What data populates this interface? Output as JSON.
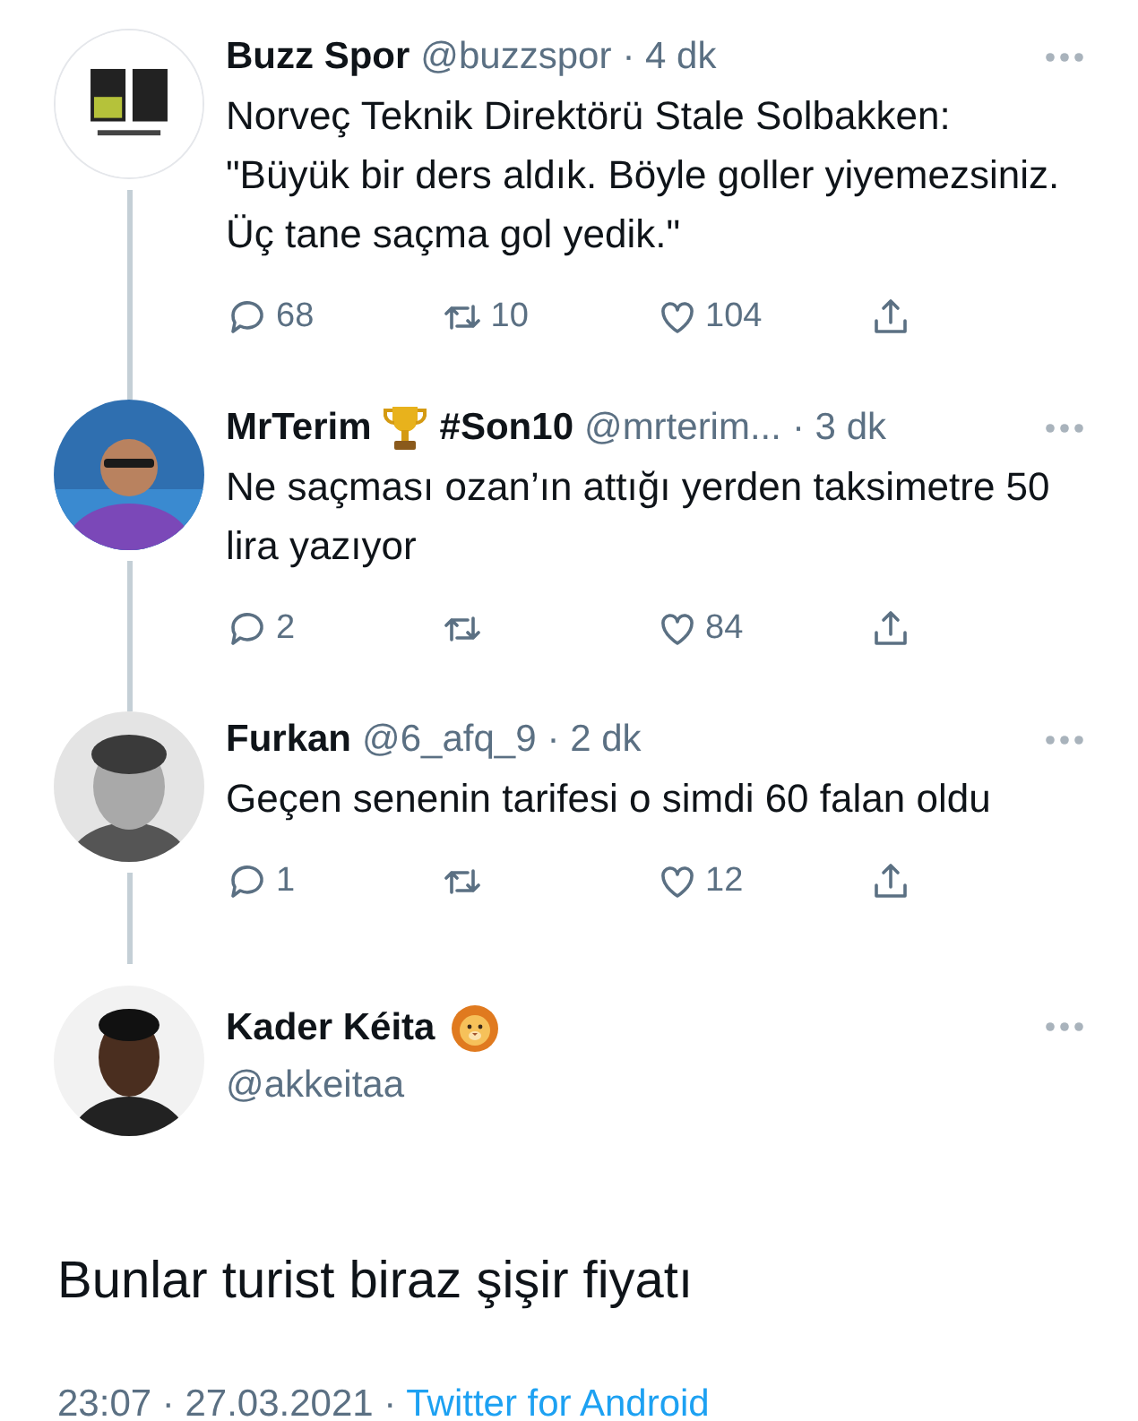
{
  "replies": [
    {
      "name": "Buzz Spor",
      "handle": "@buzzspor",
      "time": "· 4 dk",
      "avatar": {
        "kind": "logo"
      },
      "text": "Norveç Teknik Direktörü Stale Solbakken: \"Büyük bir ders aldık. Böyle goller yiyemezsiniz. Üç tane saçma gol yedik.\"",
      "replies": "68",
      "retweets": "10",
      "likes": "104"
    },
    {
      "name": "MrTerim",
      "emoji": {
        "kind": "trophy"
      },
      "tag": "#Son10",
      "handle": "@mrterim...",
      "time": "· 3 dk",
      "avatar": {
        "kind": "purple"
      },
      "text": "Ne saçması ozan’ın attığı yerden taksimetre 50 lira yazıyor",
      "replies": "2",
      "likes": "84"
    },
    {
      "name": "Furkan",
      "handle": "@6_afq_9",
      "time": "· 2 dk",
      "avatar": {
        "kind": "grey"
      },
      "text": "Geçen senenin tarifesi o simdi 60 falan oldu",
      "replies": "1",
      "likes": "12"
    }
  ],
  "main": {
    "name": "Kader Kéita",
    "emoji": {
      "kind": "lion"
    },
    "handle": "@akkeitaa",
    "text": "Bunlar turist biraz şişir fiyatı",
    "date": "23:07 · 27.03.2021 · ",
    "source": "Twitter for Android"
  }
}
